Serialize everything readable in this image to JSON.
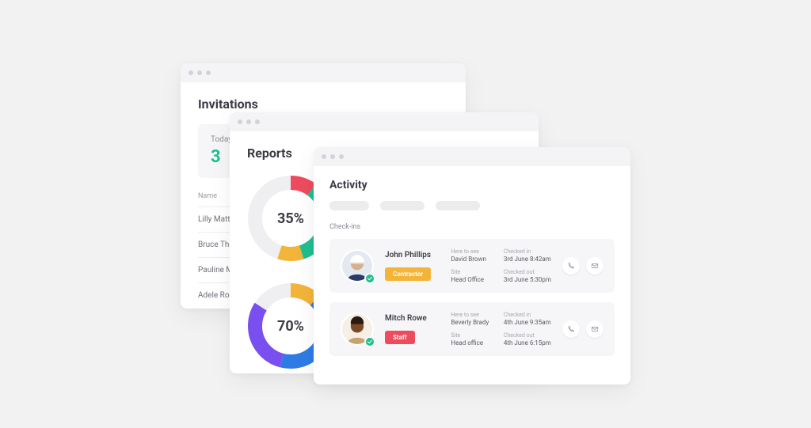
{
  "invitations": {
    "title": "Invitations",
    "summary": {
      "label": "Today",
      "value": "3"
    },
    "column": "Name",
    "rows": [
      "Lilly Matthews",
      "Bruce Thornton",
      "Pauline Mann",
      "Adele Ross"
    ]
  },
  "reports": {
    "title": "Reports",
    "donuts": [
      {
        "segments": [
          {
            "pct": 10,
            "color": "#ef4b5f"
          },
          {
            "pct": 35,
            "color": "#1fbf8f"
          },
          {
            "pct": 10,
            "color": "#f3b43a"
          },
          {
            "pct": 45,
            "color": "#efeff2"
          }
        ],
        "center": "35%"
      },
      {
        "segments": [
          {
            "pct": 12,
            "color": "#f3b43a"
          },
          {
            "pct": 42,
            "color": "#2f7be5"
          },
          {
            "pct": 30,
            "color": "#7a4ff0"
          },
          {
            "pct": 16,
            "color": "#efeff2"
          }
        ],
        "center": "70%"
      }
    ]
  },
  "activity": {
    "title": "Activity",
    "section": "Check-ins",
    "cards": [
      {
        "avatar_bg": "#e4e9f1",
        "name": "John Phillips",
        "badge": {
          "text": "Contractor",
          "class": "amber"
        },
        "here_label": "Here to see",
        "here_value": "David Brown",
        "site_label": "Site",
        "site_value": "Head Office",
        "in_label": "Checked in",
        "in_value": "3rd June 8:42am",
        "out_label": "Checked out",
        "out_value": "3rd June 5:30pm",
        "icon1": "phone",
        "icon2": "envelope"
      },
      {
        "avatar_bg": "#f5efe6",
        "name": "Mitch Rowe",
        "badge": {
          "text": "Staff",
          "class": "red"
        },
        "here_label": "Here to see",
        "here_value": "Beverly Brady",
        "site_label": "Site",
        "site_value": "Head office",
        "in_label": "Checked in",
        "in_value": "4th June 9:35am",
        "out_label": "Checked out",
        "out_value": "4th June 6:15pm",
        "icon1": "phone",
        "icon2": "envelope"
      }
    ]
  },
  "chart_data": [
    {
      "type": "pie",
      "title": "",
      "center_label": "35%",
      "series": [
        {
          "name": "seg-a",
          "color": "#ef4b5f",
          "value": 10
        },
        {
          "name": "seg-b",
          "color": "#1fbf8f",
          "value": 35
        },
        {
          "name": "seg-c",
          "color": "#f3b43a",
          "value": 10
        },
        {
          "name": "seg-d",
          "color": "#efeff2",
          "value": 45
        }
      ]
    },
    {
      "type": "pie",
      "title": "",
      "center_label": "70%",
      "series": [
        {
          "name": "seg-a",
          "color": "#f3b43a",
          "value": 12
        },
        {
          "name": "seg-b",
          "color": "#2f7be5",
          "value": 42
        },
        {
          "name": "seg-c",
          "color": "#7a4ff0",
          "value": 30
        },
        {
          "name": "seg-d",
          "color": "#efeff2",
          "value": 16
        }
      ]
    }
  ]
}
